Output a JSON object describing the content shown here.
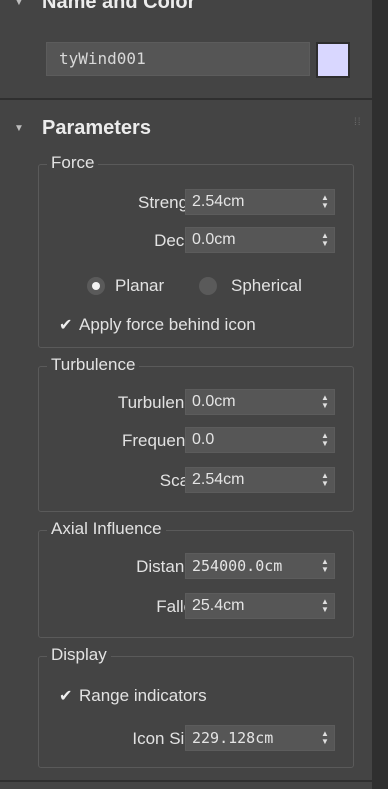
{
  "name_color": {
    "title": "Name and Color",
    "name_value": "tyWind001",
    "color": "#d9d7ff"
  },
  "parameters": {
    "title": "Parameters",
    "force": {
      "legend": "Force",
      "strength_label": "Strength:",
      "strength_value": "2.54cm",
      "decay_label": "Decay:",
      "decay_value": "0.0cm",
      "planar_label": "Planar",
      "spherical_label": "Spherical",
      "selected": "Planar",
      "apply_label": "Apply force behind icon",
      "apply_checked": true
    },
    "turbulence": {
      "legend": "Turbulence",
      "turbulence_label": "Turbulence:",
      "turbulence_value": "0.0cm",
      "frequency_label": "Frequency:",
      "frequency_value": "0.0",
      "scale_label": "Scale:",
      "scale_value": "2.54cm"
    },
    "axial": {
      "legend": "Axial Influence",
      "distance_label": "Distance:",
      "distance_value": "254000.0cm",
      "falloff_label": "Falloff:",
      "falloff_value": "25.4cm"
    },
    "display": {
      "legend": "Display",
      "range_label": "Range indicators",
      "range_checked": true,
      "icon_size_label": "Icon Size:",
      "icon_size_value": "229.128cm"
    }
  },
  "icons": {
    "collapse": "triangle-down-icon",
    "grip": "grip-dots-icon",
    "spinner": "up-down-arrows-icon",
    "check": "checkmark-icon"
  }
}
